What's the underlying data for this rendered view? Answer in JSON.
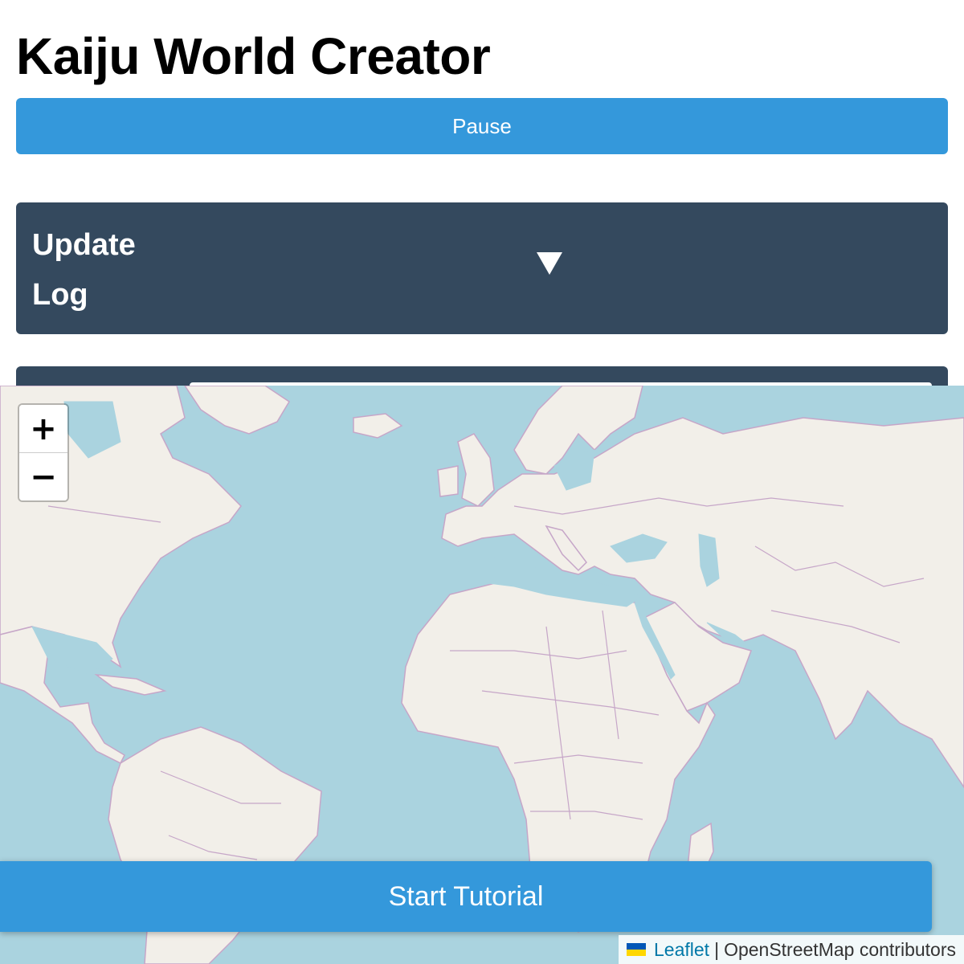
{
  "app": {
    "title": "Kaiju World Creator"
  },
  "controls": {
    "pause_label": "Pause"
  },
  "update_log": {
    "label_line1": "Update",
    "label_line2": "Log",
    "toggle_icon": "triangle-down-icon"
  },
  "map": {
    "zoom_in_label": "+",
    "zoom_out_label": "−",
    "tutorial_label": "Start Tutorial",
    "attribution": {
      "flag_icon": "ukraine-flag-icon",
      "link_text": "Leaflet",
      "separator": "|",
      "credit_text": "OpenStreetMap contributors"
    },
    "colors": {
      "water": "#aad3df",
      "land": "#f2efe9",
      "borders": "#c6a6c8"
    }
  },
  "colors": {
    "accent": "#3498db",
    "panel": "#34495e"
  }
}
